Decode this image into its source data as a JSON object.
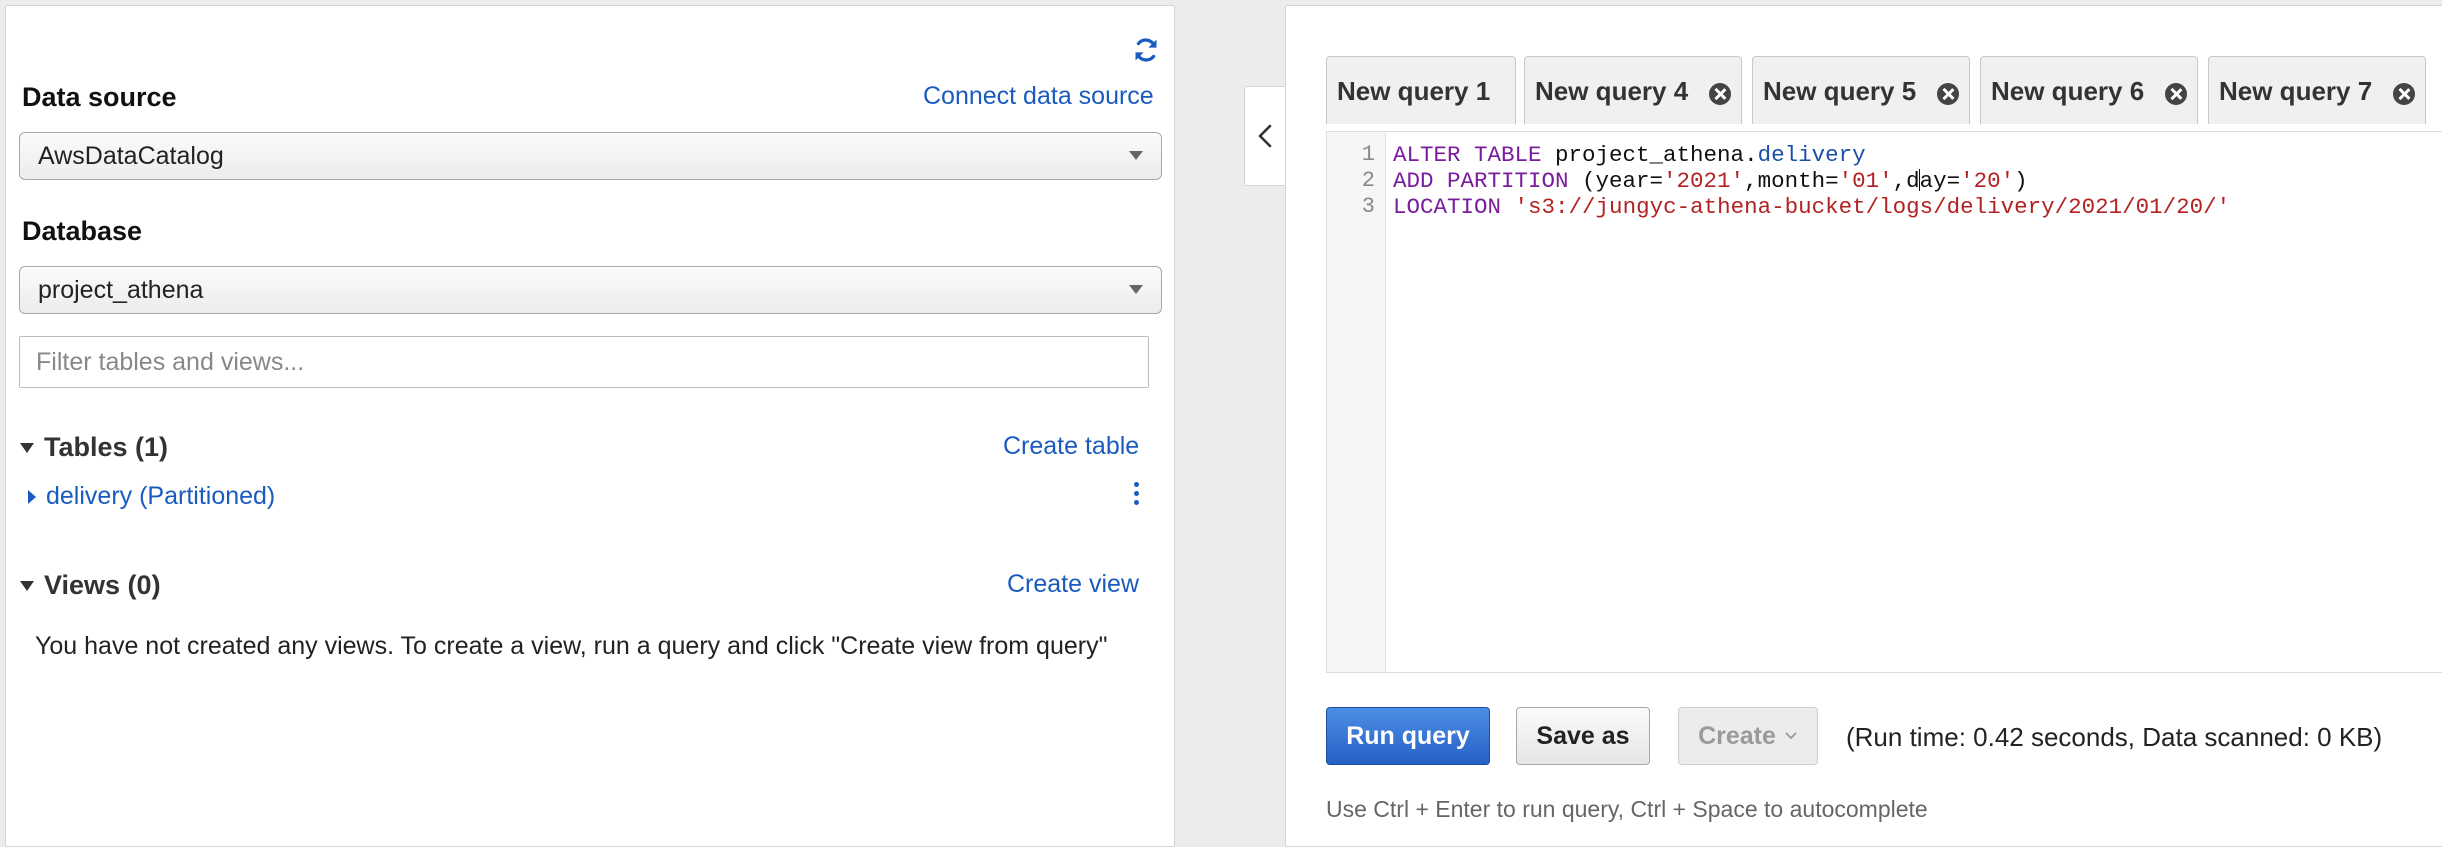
{
  "left": {
    "data_source": {
      "label": "Data source",
      "connect_link": "Connect data source",
      "value": "AwsDataCatalog"
    },
    "database": {
      "label": "Database",
      "value": "project_athena"
    },
    "filter": {
      "placeholder": "Filter tables and views..."
    },
    "tables": {
      "header": "Tables (1)",
      "create_link": "Create table",
      "items": [
        {
          "label": "delivery (Partitioned)"
        }
      ]
    },
    "views": {
      "header": "Views (0)",
      "create_link": "Create view",
      "empty_message": "You have not created any views. To create a view, run a query and click \"Create view from query\""
    }
  },
  "tabs": [
    {
      "label": "New query 1"
    },
    {
      "label": "New query 4"
    },
    {
      "label": "New query 5"
    },
    {
      "label": "New query 6"
    },
    {
      "label": "New query 7"
    }
  ],
  "editor": {
    "line_numbers": [
      "1",
      "2",
      "3"
    ],
    "lines": [
      {
        "tokens": [
          {
            "text": "ALTER TABLE",
            "cls": "kw"
          },
          {
            "text": " project_athena.",
            "cls": ""
          },
          {
            "text": "delivery",
            "cls": "fld"
          }
        ]
      },
      {
        "tokens": [
          {
            "text": "ADD PARTITION",
            "cls": "kw"
          },
          {
            "text": " (year=",
            "cls": ""
          },
          {
            "text": "'2021'",
            "cls": "str"
          },
          {
            "text": ",month=",
            "cls": ""
          },
          {
            "text": "'01'",
            "cls": "str"
          },
          {
            "text": ",d",
            "cls": ""
          },
          {
            "text": "",
            "cls": "cursor"
          },
          {
            "text": "ay=",
            "cls": ""
          },
          {
            "text": "'20'",
            "cls": "str"
          },
          {
            "text": ")",
            "cls": ""
          }
        ]
      },
      {
        "tokens": [
          {
            "text": "LOCATION",
            "cls": "kw"
          },
          {
            "text": " ",
            "cls": ""
          },
          {
            "text": "'s3://jungyc-athena-bucket/logs/delivery/2021/01/20/'",
            "cls": "str"
          }
        ]
      }
    ]
  },
  "actions": {
    "run_label": "Run query",
    "save_label": "Save as",
    "create_label": "Create",
    "run_status": "(Run time: 0.42 seconds, Data scanned: 0 KB)",
    "hint": "Use Ctrl + Enter to run query, Ctrl + Space to autocomplete"
  },
  "colors": {
    "link": "#1a5bbf",
    "primary_button": "#2461c6",
    "keyword": "#7a1c9e",
    "string": "#b22222"
  }
}
